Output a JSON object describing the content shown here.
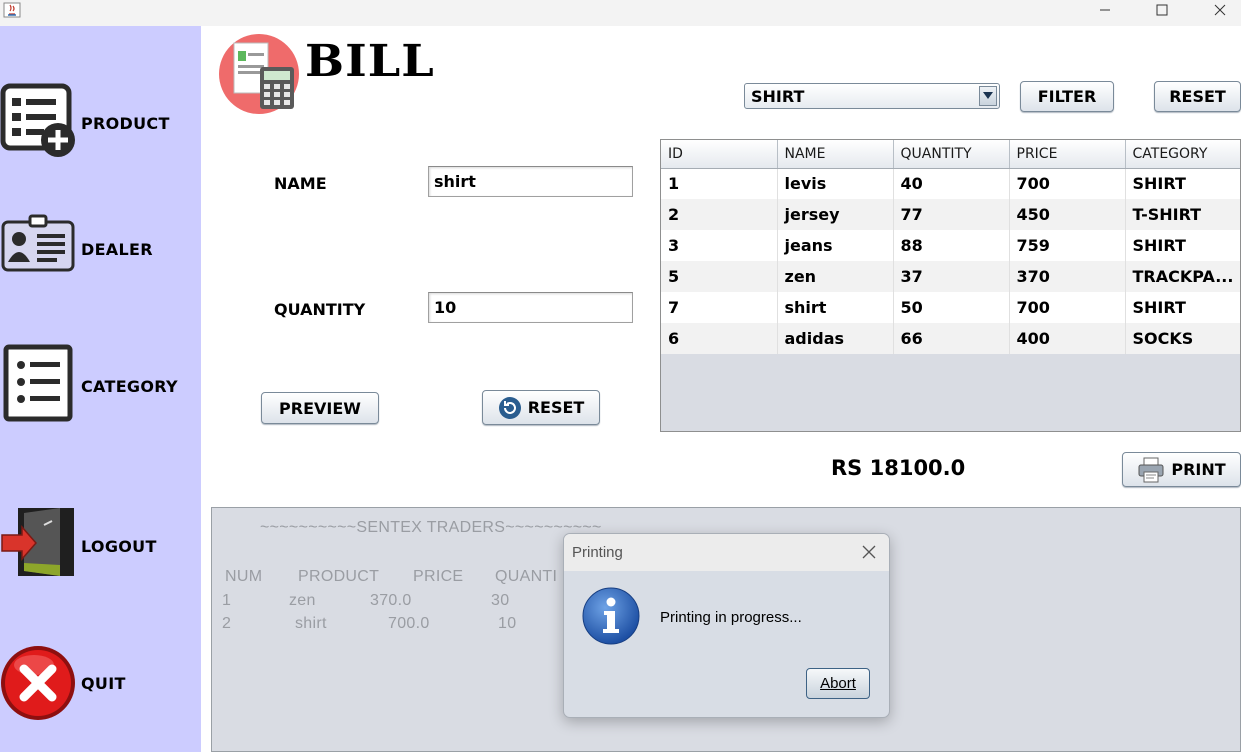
{
  "window": {
    "controls": [
      "minimize",
      "maximize",
      "close"
    ]
  },
  "sidebar": {
    "items": [
      {
        "label": "PRODUCT",
        "icon": "product-add-icon"
      },
      {
        "label": "DEALER",
        "icon": "dealer-id-card-icon"
      },
      {
        "label": "CATEGORY",
        "icon": "category-list-icon"
      },
      {
        "label": "LOGOUT",
        "icon": "logout-door-icon"
      },
      {
        "label": "QUIT",
        "icon": "quit-x-icon"
      }
    ]
  },
  "header": {
    "title": "BILL"
  },
  "form": {
    "name_label": "NAME",
    "name_value": "shirt",
    "quantity_label": "QUANTITY",
    "quantity_value": "10",
    "preview_label": "PREVIEW",
    "reset_label": "RESET"
  },
  "filter": {
    "selected": "SHIRT",
    "filter_label": "FILTER",
    "reset_label": "RESET"
  },
  "table": {
    "columns": [
      "ID",
      "NAME",
      "QUANTITY",
      "PRICE",
      "CATEGORY"
    ],
    "rows": [
      [
        "1",
        "levis",
        "40",
        "700",
        "SHIRT"
      ],
      [
        "2",
        "jersey",
        "77",
        "450",
        "T-SHIRT"
      ],
      [
        "3",
        "jeans",
        "88",
        "759",
        "SHIRT"
      ],
      [
        "5",
        "zen",
        "37",
        "370",
        "TRACKPA..."
      ],
      [
        "7",
        "shirt",
        "50",
        "700",
        "SHIRT"
      ],
      [
        "6",
        "adidas",
        "66",
        "400",
        "SOCKS"
      ]
    ]
  },
  "total": "RS 18100.0",
  "print_label": "PRINT",
  "receipt": {
    "header": "~~~~~~~~~~SENTEX TRADERS~~~~~~~~~~",
    "columns": [
      "NUM",
      "PRODUCT",
      "PRICE",
      "QUANTI"
    ],
    "lines": [
      [
        "1",
        "zen",
        "370.0",
        "30"
      ],
      [
        "2",
        "shirt",
        "700.0",
        "10"
      ]
    ]
  },
  "dialog": {
    "title": "Printing",
    "message": "Printing in progress...",
    "button": "Abort"
  },
  "colors": {
    "sidebar": "#ccccff",
    "panel": "#d9dce3"
  }
}
